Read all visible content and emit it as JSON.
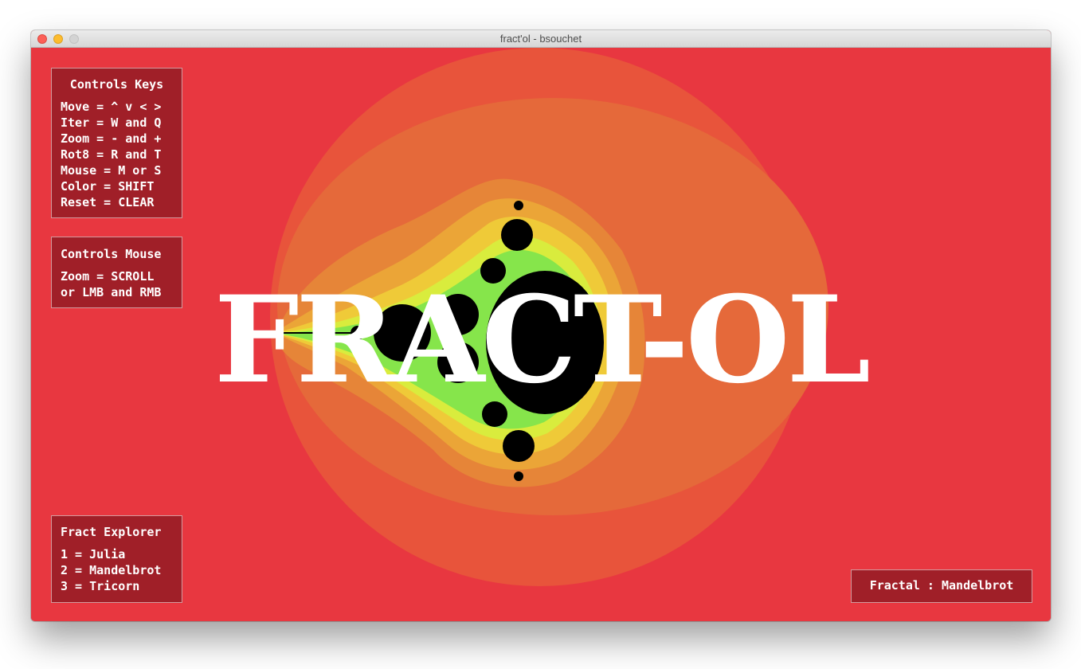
{
  "window": {
    "title": "fract'ol - bsouchet"
  },
  "canvas": {
    "title_text": "FRACT-OL",
    "fractal_name": "Mandelbrot",
    "colors": {
      "background": "#e83740",
      "panel": "#a01f28",
      "bands": [
        "#e8503b",
        "#e66b3a",
        "#e88d38",
        "#ecb137",
        "#f0d43a",
        "#d8ec3c",
        "#8fe84a",
        "#3cc9a8"
      ],
      "interior": "#000000"
    }
  },
  "panels": {
    "keys": {
      "title": "Controls Keys",
      "lines": [
        "Move = ^ v < >",
        "Iter = W and Q",
        "Zoom = - and +",
        "Rot8 = R and T",
        "Mouse = M or S",
        "Color = SHIFT",
        "Reset = CLEAR"
      ]
    },
    "mouse": {
      "title": "Controls Mouse",
      "lines": [
        "Zoom = SCROLL",
        "or LMB and RMB"
      ]
    },
    "explorer": {
      "title": "Fract Explorer",
      "lines": [
        "1 = Julia",
        "2 = Mandelbrot",
        "3 = Tricorn"
      ]
    },
    "status": {
      "text": "Fractal : Mandelbrot"
    }
  }
}
